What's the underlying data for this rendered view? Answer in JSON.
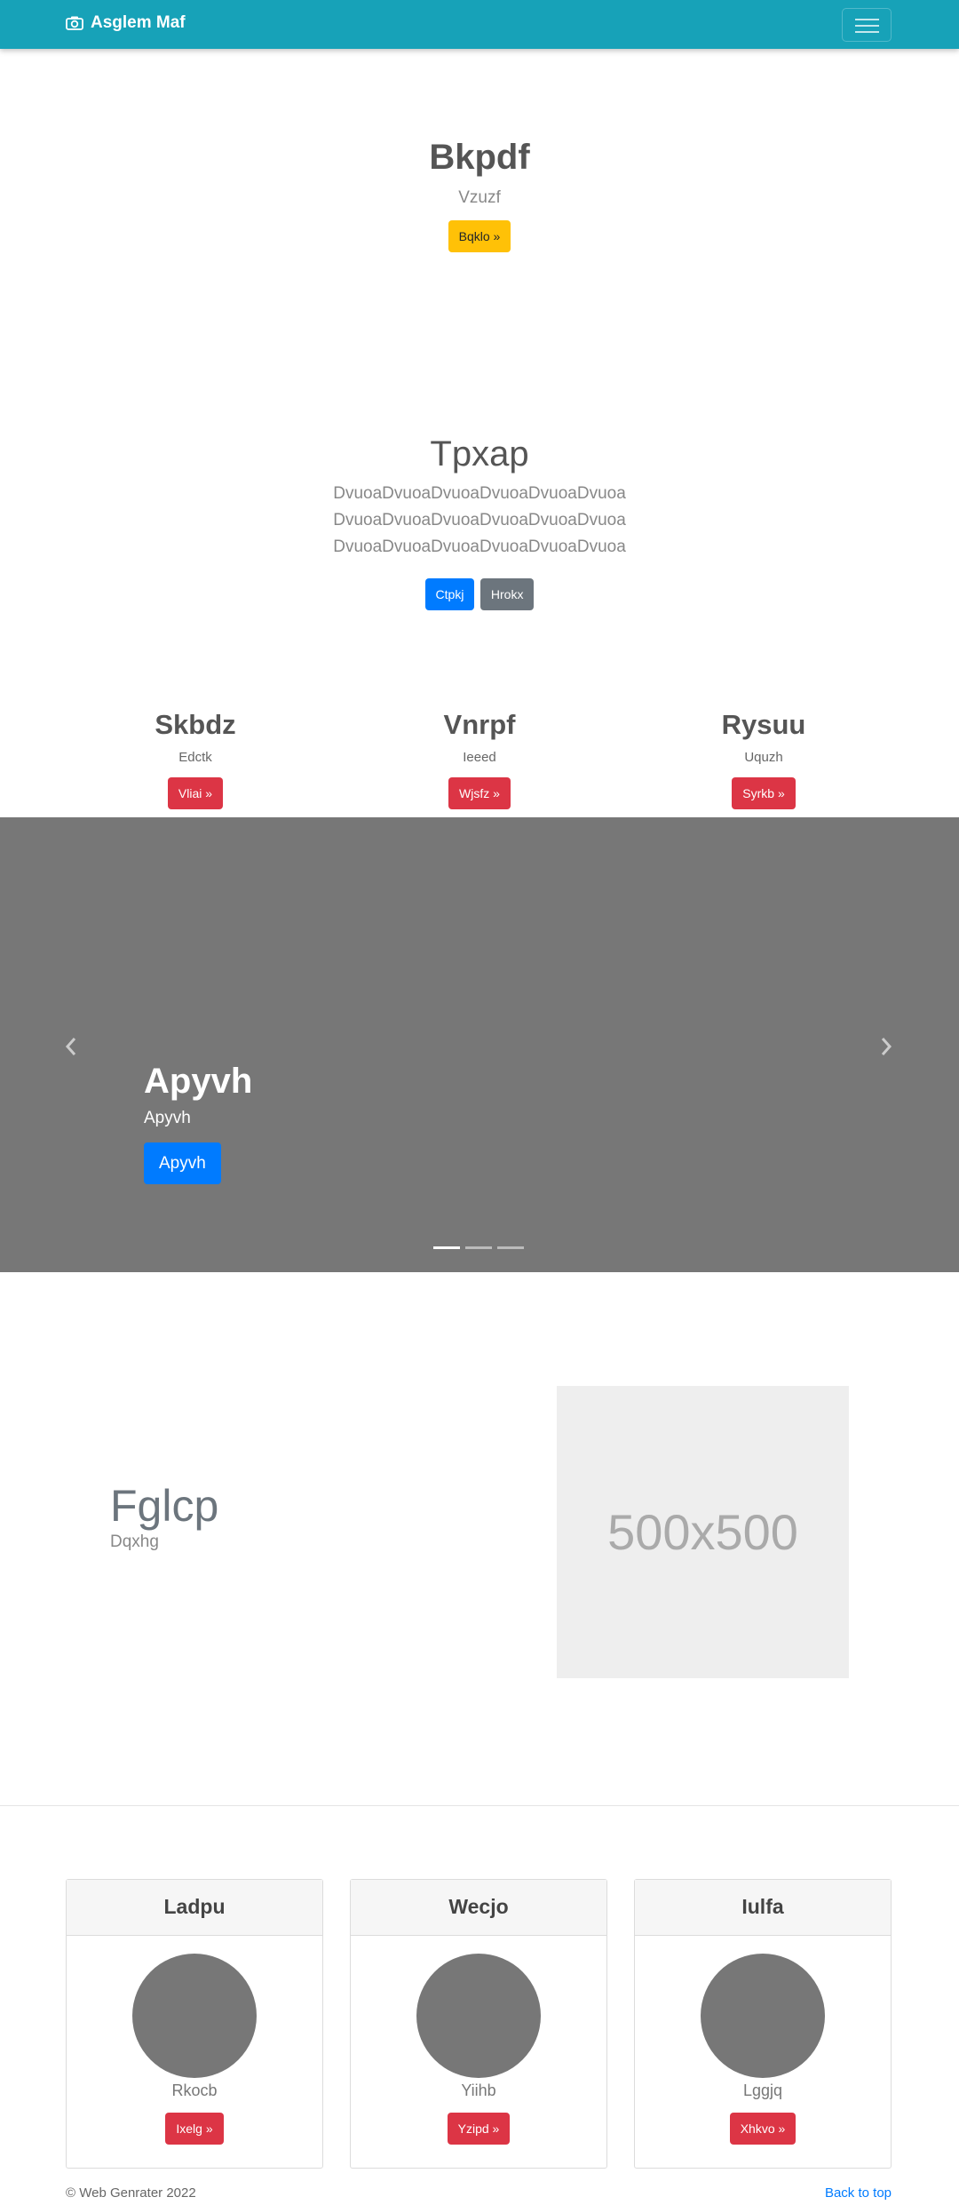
{
  "nav": {
    "brand": "Asglem Maf"
  },
  "hero": {
    "title": "Bkpdf",
    "subtitle": "Vzuzf",
    "button": "Bqklo »"
  },
  "intro": {
    "title": "Tpxap",
    "lines": [
      "DvuoaDvuoaDvuoaDvuoaDvuoaDvuoa",
      "DvuoaDvuoaDvuoaDvuoaDvuoaDvuoa",
      "DvuoaDvuoaDvuoaDvuoaDvuoaDvuoa"
    ],
    "button_primary": "Ctpkj",
    "button_secondary": "Hrokx"
  },
  "features": [
    {
      "title": "Skbdz",
      "subtitle": "Edctk",
      "button": "Vliai »"
    },
    {
      "title": "Vnrpf",
      "subtitle": "Ieeed",
      "button": "Wjsfz »"
    },
    {
      "title": "Rysuu",
      "subtitle": "Uquzh",
      "button": "Syrkb »"
    }
  ],
  "carousel": {
    "caption_title": "Apyvh",
    "caption_text": "Apyvh",
    "caption_button": "Apyvh",
    "prev_icon": "chevron-left-icon",
    "next_icon": "chevron-right-icon",
    "slide_count": 3,
    "active_slide": 1
  },
  "featurette": {
    "title": "Fglcp",
    "subtitle": "Dqxhg",
    "placeholder": "500x500"
  },
  "cards": [
    {
      "title": "Ladpu",
      "subtitle": "Rkocb",
      "button": "Ixelg »"
    },
    {
      "title": "Wecjo",
      "subtitle": "Yiihb",
      "button": "Yzipd »"
    },
    {
      "title": "Iulfa",
      "subtitle": "Lggjq",
      "button": "Xhkvo »"
    }
  ],
  "footer": {
    "copyright": "© Web Genrater 2022",
    "back_to_top": "Back to top"
  },
  "colors": {
    "navbar": "#17a2b8",
    "yellow": "#ffc107",
    "blue": "#007bff",
    "red": "#dc3545",
    "gray": "#6c757d"
  }
}
